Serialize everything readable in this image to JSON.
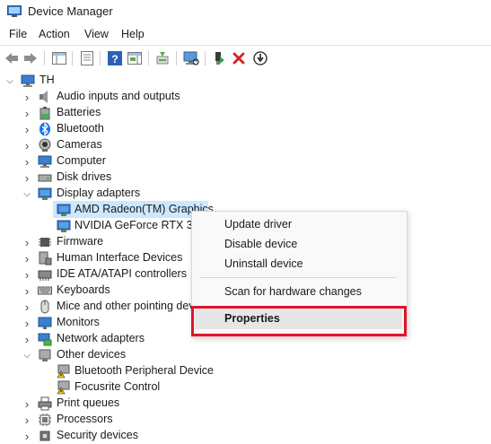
{
  "window": {
    "title": "Device Manager",
    "icon": "device-manager-icon"
  },
  "menu": [
    "File",
    "Action",
    "View",
    "Help"
  ],
  "toolbar": {
    "buttons": [
      "back-icon",
      "forward-icon",
      "show-hide-console-tree-icon",
      "properties-icon",
      "help-icon",
      "action-pane-icon",
      "update-driver-icon",
      "scan-hardware-icon",
      "enable-device-icon",
      "uninstall-device-icon",
      "disable-device-icon"
    ]
  },
  "tree": {
    "root": "TH",
    "items": [
      {
        "label": "Audio inputs and outputs",
        "expanded": false,
        "icon": "speaker-icon"
      },
      {
        "label": "Batteries",
        "expanded": false,
        "icon": "battery-icon"
      },
      {
        "label": "Bluetooth",
        "expanded": false,
        "icon": "bluetooth-icon"
      },
      {
        "label": "Cameras",
        "expanded": false,
        "icon": "camera-icon"
      },
      {
        "label": "Computer",
        "expanded": false,
        "icon": "computer-icon"
      },
      {
        "label": "Disk drives",
        "expanded": false,
        "icon": "disk-drive-icon"
      },
      {
        "label": "Display adapters",
        "expanded": true,
        "icon": "display-adapter-icon"
      },
      {
        "label": "AMD Radeon(TM) Graphics",
        "child": true,
        "selected": true,
        "icon": "display-adapter-icon"
      },
      {
        "label": "NVIDIA GeForce RTX 3060",
        "child": true,
        "icon": "display-adapter-icon"
      },
      {
        "label": "Firmware",
        "expanded": false,
        "icon": "firmware-icon"
      },
      {
        "label": "Human Interface Devices",
        "expanded": false,
        "icon": "hid-icon"
      },
      {
        "label": "IDE ATA/ATAPI controllers",
        "expanded": false,
        "icon": "ide-controller-icon"
      },
      {
        "label": "Keyboards",
        "expanded": false,
        "icon": "keyboard-icon"
      },
      {
        "label": "Mice and other pointing devices",
        "expanded": false,
        "icon": "mouse-icon"
      },
      {
        "label": "Monitors",
        "expanded": false,
        "icon": "monitor-icon"
      },
      {
        "label": "Network adapters",
        "expanded": false,
        "icon": "network-adapter-icon"
      },
      {
        "label": "Other devices",
        "expanded": true,
        "icon": "other-devices-icon"
      },
      {
        "label": "Bluetooth Peripheral Device",
        "child": true,
        "icon": "warning-device-icon"
      },
      {
        "label": "Focusrite Control",
        "child": true,
        "icon": "warning-device-icon"
      },
      {
        "label": "Print queues",
        "expanded": false,
        "icon": "printer-icon"
      },
      {
        "label": "Processors",
        "expanded": false,
        "icon": "processor-icon"
      },
      {
        "label": "Security devices",
        "expanded": false,
        "icon": "security-device-icon"
      }
    ]
  },
  "context_menu": {
    "update_driver": "Update driver",
    "disable_device": "Disable device",
    "uninstall_device": "Uninstall device",
    "scan": "Scan for hardware changes",
    "properties": "Properties"
  },
  "colors": {
    "selection": "#cce8ff",
    "highlight_box": "#e0142a"
  }
}
